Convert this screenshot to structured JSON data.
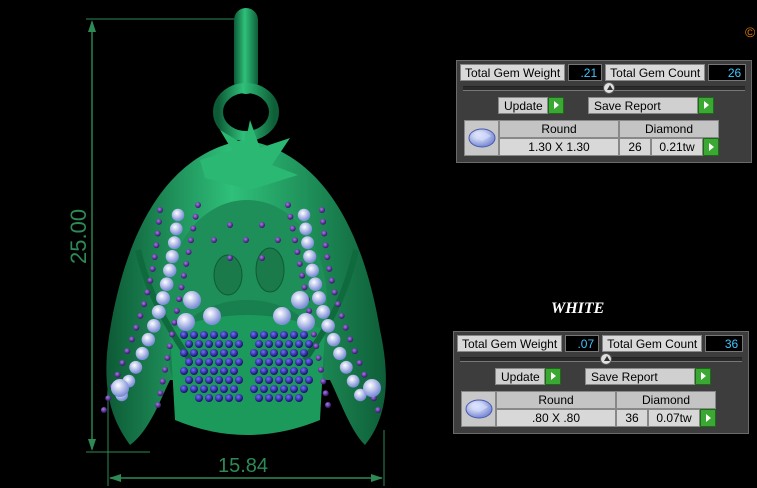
{
  "dimensions": {
    "height": "25.00",
    "width": "15.84"
  },
  "corner_icon": "copyright-like-icon",
  "panel_top": {
    "total_gem_weight_label": "Total Gem Weight",
    "total_gem_weight": ".21",
    "total_gem_count_label": "Total Gem Count",
    "total_gem_count": "26",
    "update_label": "Update",
    "save_report_label": "Save Report",
    "gem": {
      "shape": "Round",
      "size": "1.30 X 1.30",
      "material": "Diamond",
      "count": "26",
      "weight": "0.21tw"
    }
  },
  "white_label": "WHITE",
  "panel_bottom": {
    "total_gem_weight_label": "Total Gem Weight",
    "total_gem_weight": ".07",
    "total_gem_count_label": "Total Gem Count",
    "total_gem_count": "36",
    "update_label": "Update",
    "save_report_label": "Save Report",
    "gem": {
      "shape": "Round",
      "size": ".80 X .80",
      "material": "Diamond",
      "count": "36",
      "weight": "0.07tw"
    }
  },
  "colors": {
    "metal": "#1fa064",
    "dim_line": "#2e8a55",
    "gem_white": "#b8c8f0",
    "gem_purple": "#5a2a9c",
    "gem_blue": "#3a2ab0",
    "value_text": "#3fc6ff"
  }
}
